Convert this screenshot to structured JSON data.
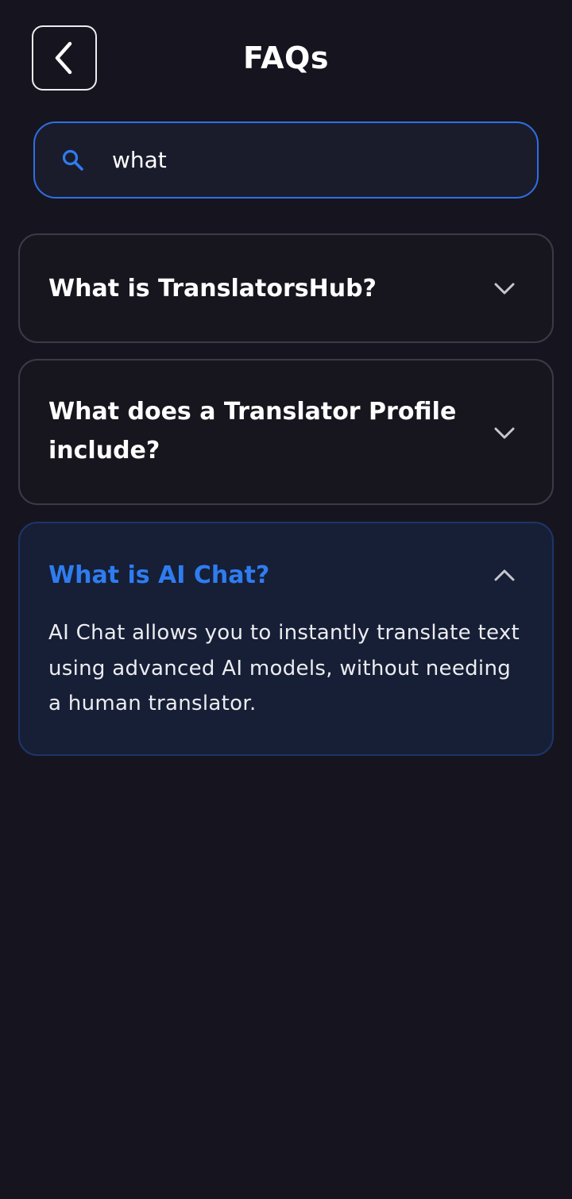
{
  "header": {
    "title": "FAQs"
  },
  "search": {
    "value": "what",
    "icon": "search-icon"
  },
  "faqs": [
    {
      "question": "What is TranslatorsHub?",
      "expanded": false,
      "answer": ""
    },
    {
      "question": "What does a Translator Profile include?",
      "expanded": false,
      "answer": ""
    },
    {
      "question": "What is AI Chat?",
      "expanded": true,
      "answer": "AI Chat allows you to instantly translate text using advanced AI models, without needing a human translator."
    }
  ],
  "colors": {
    "background": "#16151f",
    "accent": "#2f7cf0",
    "card_border": "#3b3b45",
    "open_card_bg": "#161f36"
  }
}
